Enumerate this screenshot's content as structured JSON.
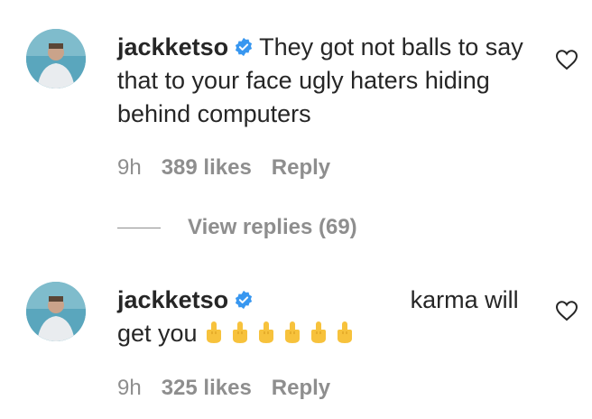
{
  "comments": [
    {
      "username": "jackketso",
      "text": "They got not balls to say that to your face ugly haters hiding behind computers",
      "time": "9h",
      "likes": "389 likes",
      "reply_label": "Reply",
      "icons": [
        "avatar",
        "verified-badge-icon",
        "heart-icon"
      ]
    },
    {
      "username": "jackketso",
      "text_after": "karma will get you",
      "emoji_count": 6,
      "time": "9h",
      "likes": "325 likes",
      "reply_label": "Reply",
      "icons": [
        "avatar",
        "verified-badge-icon",
        "heart-icon",
        "middle-finger-emoji"
      ]
    }
  ],
  "view_replies": "View replies (69)",
  "colors": {
    "text": "#262626",
    "secondary": "#8e8e8e",
    "verified": "#3897f0"
  }
}
